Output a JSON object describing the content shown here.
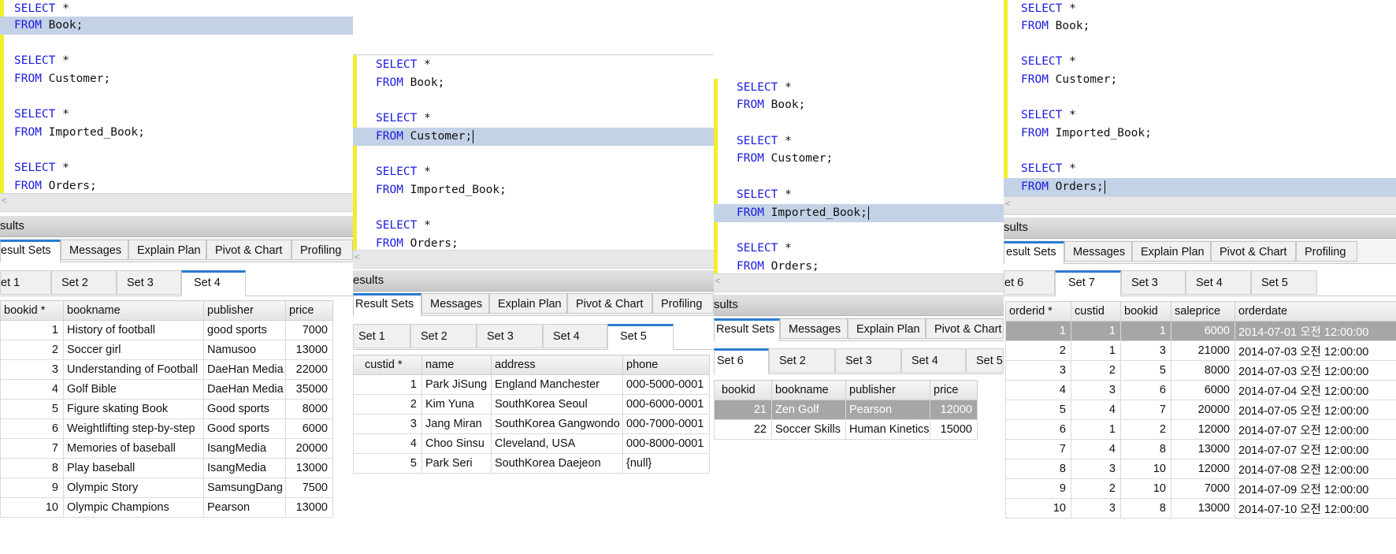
{
  "code": {
    "kw_select": "SELECT",
    "star": " *",
    "kw_from": "FROM",
    "book": " Book;",
    "customer": " Customer;",
    "imported": " Imported_Book;",
    "orders": " Orders;"
  },
  "results_label": "Results",
  "panel1": {
    "results_label": "sults",
    "tabs": [
      "esult Sets",
      "Messages",
      "Explain Plan",
      "Pivot & Chart",
      "Profiling"
    ],
    "sets": [
      "et 1",
      "Set 2",
      "Set 3",
      "Set 4"
    ],
    "columns": [
      "bookid *",
      "bookname",
      "publisher",
      "price"
    ],
    "rows": [
      [
        "1",
        "History of football",
        "good sports",
        "7000"
      ],
      [
        "2",
        "Soccer girl",
        "Namusoo",
        "13000"
      ],
      [
        "3",
        "Understanding of Football",
        "DaeHan Media",
        "22000"
      ],
      [
        "4",
        "Golf Bible",
        "DaeHan Media",
        "35000"
      ],
      [
        "5",
        "Figure skating Book",
        "Good sports",
        "8000"
      ],
      [
        "6",
        "Weightlifting step-by-step",
        "Good sports",
        "6000"
      ],
      [
        "7",
        "Memories of baseball",
        "IsangMedia",
        "20000"
      ],
      [
        "8",
        "Play baseball",
        "IsangMedia",
        "13000"
      ],
      [
        "9",
        "Olympic Story",
        "SamsungDang",
        "7500"
      ],
      [
        "10",
        "Olympic Champions",
        "Pearson",
        "13000"
      ]
    ]
  },
  "panel2": {
    "results_label": "esults",
    "tabs": [
      "Result Sets",
      "Messages",
      "Explain Plan",
      "Pivot & Chart",
      "Profiling"
    ],
    "sets": [
      "Set 1",
      "Set 2",
      "Set 3",
      "Set 4",
      "Set 5"
    ],
    "columns": [
      "custid *",
      "name",
      "address",
      "phone"
    ],
    "rows": [
      [
        "1",
        "Park JiSung",
        "England Manchester",
        "000-5000-0001"
      ],
      [
        "2",
        "Kim Yuna",
        "SouthKorea Seoul",
        "000-6000-0001"
      ],
      [
        "3",
        "Jang Miran",
        "SouthKorea Gangwondo",
        "000-7000-0001"
      ],
      [
        "4",
        "Choo Sinsu",
        "Cleveland, USA",
        "000-8000-0001"
      ],
      [
        "5",
        "Park Seri",
        "SouthKorea Daejeon",
        "{null}"
      ]
    ]
  },
  "panel3": {
    "results_label": "sults",
    "tabs": [
      "Result Sets",
      "Messages",
      "Explain Plan",
      "Pivot & Chart"
    ],
    "sets": [
      "Set 6",
      "Set 2",
      "Set 3",
      "Set 4",
      "Set 5"
    ],
    "columns": [
      "bookid",
      "bookname",
      "publisher",
      "price"
    ],
    "rows": [
      [
        "21",
        "Zen Golf",
        "Pearson",
        "12000"
      ],
      [
        "22",
        "Soccer Skills",
        "Human Kinetics",
        "15000"
      ]
    ]
  },
  "panel4": {
    "results_label": "sults",
    "tabs": [
      "esult Sets",
      "Messages",
      "Explain Plan",
      "Pivot & Chart",
      "Profiling"
    ],
    "sets": [
      "et 6",
      "Set 7",
      "Set 3",
      "Set 4",
      "Set 5"
    ],
    "columns": [
      "orderid *",
      "custid",
      "bookid",
      "saleprice",
      "orderdate"
    ],
    "rows": [
      [
        "1",
        "1",
        "1",
        "6000",
        "2014-07-01 오전 12:00:00"
      ],
      [
        "2",
        "1",
        "3",
        "21000",
        "2014-07-03 오전 12:00:00"
      ],
      [
        "3",
        "2",
        "5",
        "8000",
        "2014-07-03 오전 12:00:00"
      ],
      [
        "4",
        "3",
        "6",
        "6000",
        "2014-07-04 오전 12:00:00"
      ],
      [
        "5",
        "4",
        "7",
        "20000",
        "2014-07-05 오전 12:00:00"
      ],
      [
        "6",
        "1",
        "2",
        "12000",
        "2014-07-07 오전 12:00:00"
      ],
      [
        "7",
        "4",
        "8",
        "13000",
        "2014-07-07 오전 12:00:00"
      ],
      [
        "8",
        "3",
        "10",
        "12000",
        "2014-07-08 오전 12:00:00"
      ],
      [
        "9",
        "2",
        "10",
        "7000",
        "2014-07-09 오전 12:00:00"
      ],
      [
        "10",
        "3",
        "8",
        "13000",
        "2014-07-10 오전 12:00:00"
      ]
    ]
  }
}
